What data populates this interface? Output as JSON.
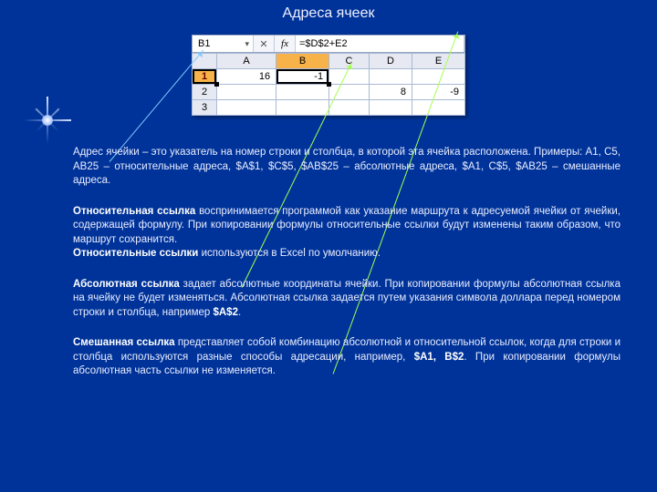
{
  "title": "Адреса ячеек",
  "formula_bar": {
    "name_box": "B1",
    "fx_label": "fx",
    "value": "=$D$2+E2"
  },
  "grid": {
    "col_headers": [
      "A",
      "B",
      "C",
      "D",
      "E"
    ],
    "row_headers": [
      "1",
      "2",
      "3"
    ],
    "cells": {
      "A1": "16",
      "B1": "-1",
      "D2": "8",
      "E2": "-9"
    },
    "selected_cell": "B1"
  },
  "paragraphs": {
    "p1": "Адрес ячейки – это указатель на номер строки и столбца, в которой эта ячейка расположена. Примеры: A1, C5, AB25 – относительные адреса, $A$1, $C$5, $AB$25 – абсолютные адреса, $A1, C$5, $AB25 – смешанные адреса.",
    "p2a_bold": "Относительная ссылка",
    "p2a": " воспринимается программой как указание маршрута к адресуемой ячейки от ячейки, содержащей формулу. При копировании формулы относительные ссылки будут изменены таким образом, что маршрут сохранится.",
    "p2b_bold": "Относительные ссылки",
    "p2b": " используются в Excel по умолчанию.",
    "p3_bold": "Абсолютная ссылка",
    "p3": " задает абсолютные координаты ячейки. При копировании формулы абсолютная ссылка на ячейку не будет изменяться. Абсолютная ссылка задается путем указания символа доллара перед номером строки и столбца, например ",
    "p3_ex": "$A$2",
    "p3_end": ".",
    "p4_bold": "Смешанная ссылка",
    "p4": " представляет собой комбинацию абсолютной и относительной ссылок, когда для строки и столбца используются разные способы адресации, например, ",
    "p4_ex": "$A1, B$2",
    "p4_end": ". При копировании формулы абсолютная часть ссылки не изменяется."
  }
}
